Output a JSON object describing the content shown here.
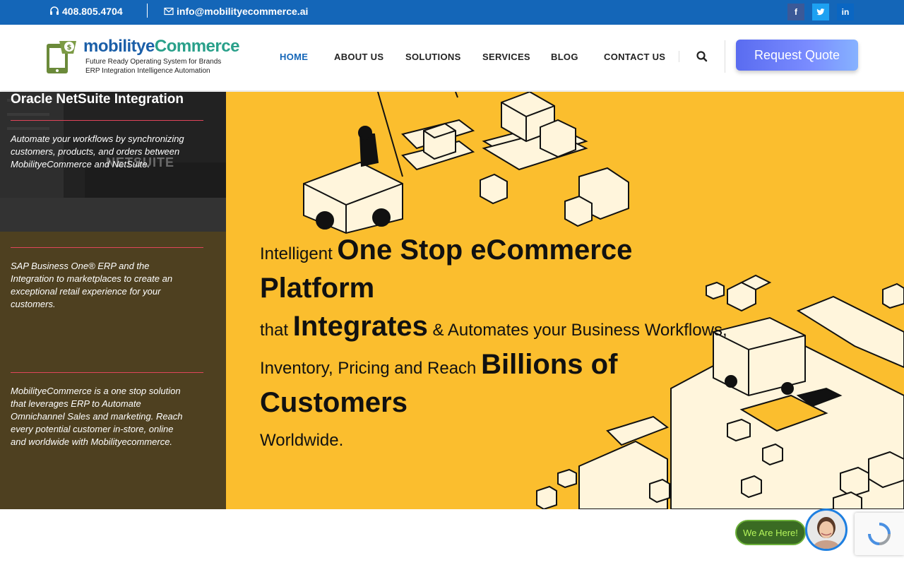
{
  "topbar": {
    "phone": "408.805.4704",
    "email": "info@mobilityecommerce.ai",
    "social": [
      "f",
      "t",
      "in"
    ]
  },
  "logo": {
    "name_part1": "mobilitye",
    "name_part2": "Commerce",
    "tagline1": "Future Ready Operating System for Brands",
    "tagline2": "ERP Integration Intelligence Automation"
  },
  "nav": {
    "items": [
      "HOME",
      "ABOUT US",
      "SOLUTIONS",
      "SERVICES",
      "BLOG",
      "CONTACT US"
    ],
    "active": "HOME",
    "quote_button": "Request Quote"
  },
  "sidebar": {
    "slides": [
      {
        "title": "Oracle NetSuite Integration",
        "text": "Automate your workflows by synchronizing customers, products, and orders between MobilityeCommerce and NetSuite.",
        "bg_label": "NETSUITE"
      },
      {
        "text": "SAP Business One® ERP and the Integration to marketplaces to create an exceptional retail experience for your customers."
      },
      {
        "text": "MobilityeCommerce is a one stop solution that leverages ERP to Automate Omnichannel Sales and marketing. Reach every potential customer in-store, online and worldwide with Mobilityecommerce."
      }
    ]
  },
  "hero": {
    "line1_small": "Intelligent",
    "line1_big": "One Stop eCommerce Platform",
    "line2_small": "that",
    "line2_big": "Integrates",
    "line2_rest": "& Automates your Business Workflows,",
    "line3_small": "Inventory, Pricing and Reach",
    "line3_big": "Billions of Customers",
    "line4": "Worldwide."
  },
  "chat": {
    "badge": "We Are Here!"
  },
  "colors": {
    "topbar": "#1466b8",
    "hero_bg": "#fbbe2e",
    "sidebar_bg": "#4e4020",
    "accent_line": "#e0455a"
  }
}
